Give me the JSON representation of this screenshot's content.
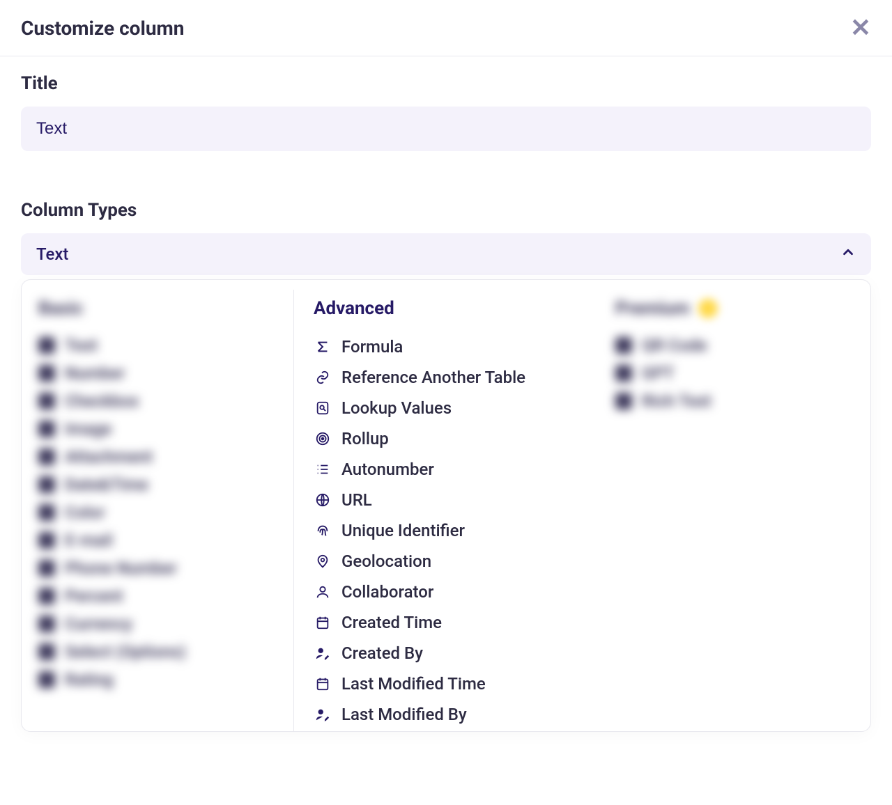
{
  "modal": {
    "title": "Customize column",
    "title_label": "Title",
    "title_value": "Text",
    "types_label": "Column Types",
    "types_value": "Text"
  },
  "columns": {
    "basic": {
      "heading": "Basic",
      "items": [
        {
          "label": "Text"
        },
        {
          "label": "Number"
        },
        {
          "label": "Checkbox"
        },
        {
          "label": "Image"
        },
        {
          "label": "Attachment"
        },
        {
          "label": "Date&Time"
        },
        {
          "label": "Color"
        },
        {
          "label": "E-mail"
        },
        {
          "label": "Phone Number"
        },
        {
          "label": "Percent"
        },
        {
          "label": "Currency"
        },
        {
          "label": "Select (Options)"
        },
        {
          "label": "Rating"
        }
      ]
    },
    "advanced": {
      "heading": "Advanced",
      "items": [
        {
          "label": "Formula",
          "icon": "sigma"
        },
        {
          "label": "Reference Another Table",
          "icon": "link"
        },
        {
          "label": "Lookup Values",
          "icon": "lookup"
        },
        {
          "label": "Rollup",
          "icon": "rollup"
        },
        {
          "label": "Autonumber",
          "icon": "autonum"
        },
        {
          "label": "URL",
          "icon": "globe"
        },
        {
          "label": "Unique Identifier",
          "icon": "fingerprint"
        },
        {
          "label": "Geolocation",
          "icon": "pin"
        },
        {
          "label": "Collaborator",
          "icon": "user"
        },
        {
          "label": "Created Time",
          "icon": "cal"
        },
        {
          "label": "Created By",
          "icon": "users"
        },
        {
          "label": "Last Modified Time",
          "icon": "cal"
        },
        {
          "label": "Last Modified By",
          "icon": "users"
        }
      ]
    },
    "premium": {
      "heading": "Premium",
      "items": [
        {
          "label": "QR Code"
        },
        {
          "label": "GPT"
        },
        {
          "label": "Rich Text"
        }
      ]
    }
  }
}
